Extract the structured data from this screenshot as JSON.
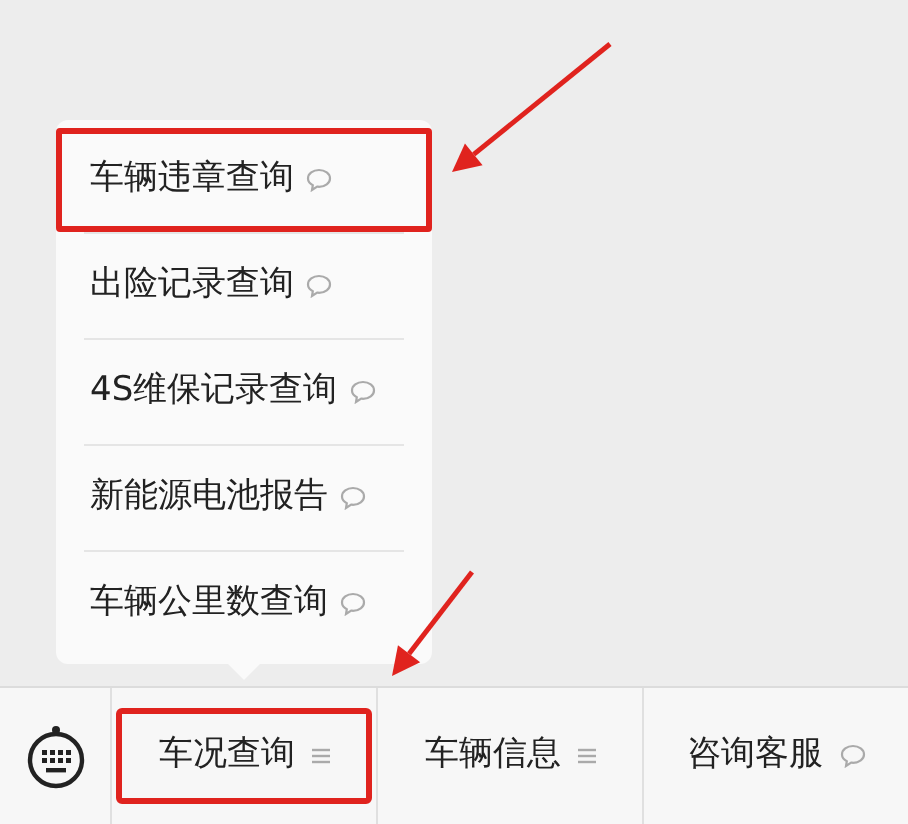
{
  "popup_menu": {
    "items": [
      {
        "label": "车辆违章查询",
        "highlighted": true
      },
      {
        "label": "出险记录查询",
        "highlighted": false
      },
      {
        "label": "4S维保记录查询",
        "highlighted": false
      },
      {
        "label": "新能源电池报告",
        "highlighted": false
      },
      {
        "label": "车辆公里数查询",
        "highlighted": false
      }
    ]
  },
  "bottom_menu": {
    "buttons": [
      {
        "label": "车况查询",
        "kind": "submenu",
        "highlighted": true
      },
      {
        "label": "车辆信息",
        "kind": "submenu",
        "highlighted": false
      },
      {
        "label": "咨询客服",
        "kind": "message",
        "highlighted": false
      }
    ]
  },
  "annotations": [
    {
      "kind": "arrow"
    },
    {
      "kind": "arrow"
    }
  ]
}
